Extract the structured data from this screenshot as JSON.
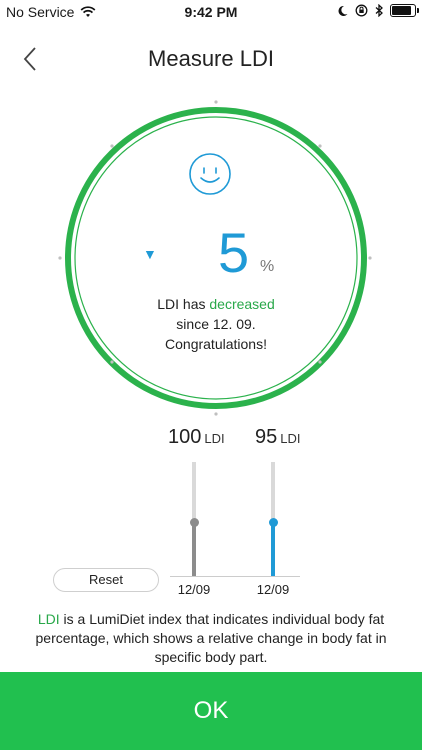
{
  "status_bar": {
    "carrier": "No Service",
    "time": "9:42 PM",
    "battery_level": 0.95
  },
  "header": {
    "title": "Measure LDI",
    "back_icon": "chevron-left-icon"
  },
  "result": {
    "icon": "smiley-icon",
    "trend_icon": "triangle-down-icon",
    "value": "5",
    "unit": "%",
    "message_prefix": "LDI has ",
    "message_highlight": "decreased",
    "message_line2": "since 12. 09.",
    "message_line3": "Congratulations!"
  },
  "comparison": {
    "previous": {
      "value": "100",
      "unit": "LDI",
      "date": "12/09",
      "level": 0.47
    },
    "current": {
      "value": "95",
      "unit": "LDI",
      "date": "12/09",
      "level": 0.47
    }
  },
  "reset_label": "Reset",
  "description": {
    "highlight": "LDI",
    "text": " is a LumiDiet index that indicates individual body fat percentage, which shows a relative change in body fat in specific body part."
  },
  "ok_label": "OK",
  "colors": {
    "accent_green": "#21c04f",
    "ring_green": "#2bb24c",
    "blue": "#1f9ad6",
    "gray_bar": "#8c8c8c"
  }
}
